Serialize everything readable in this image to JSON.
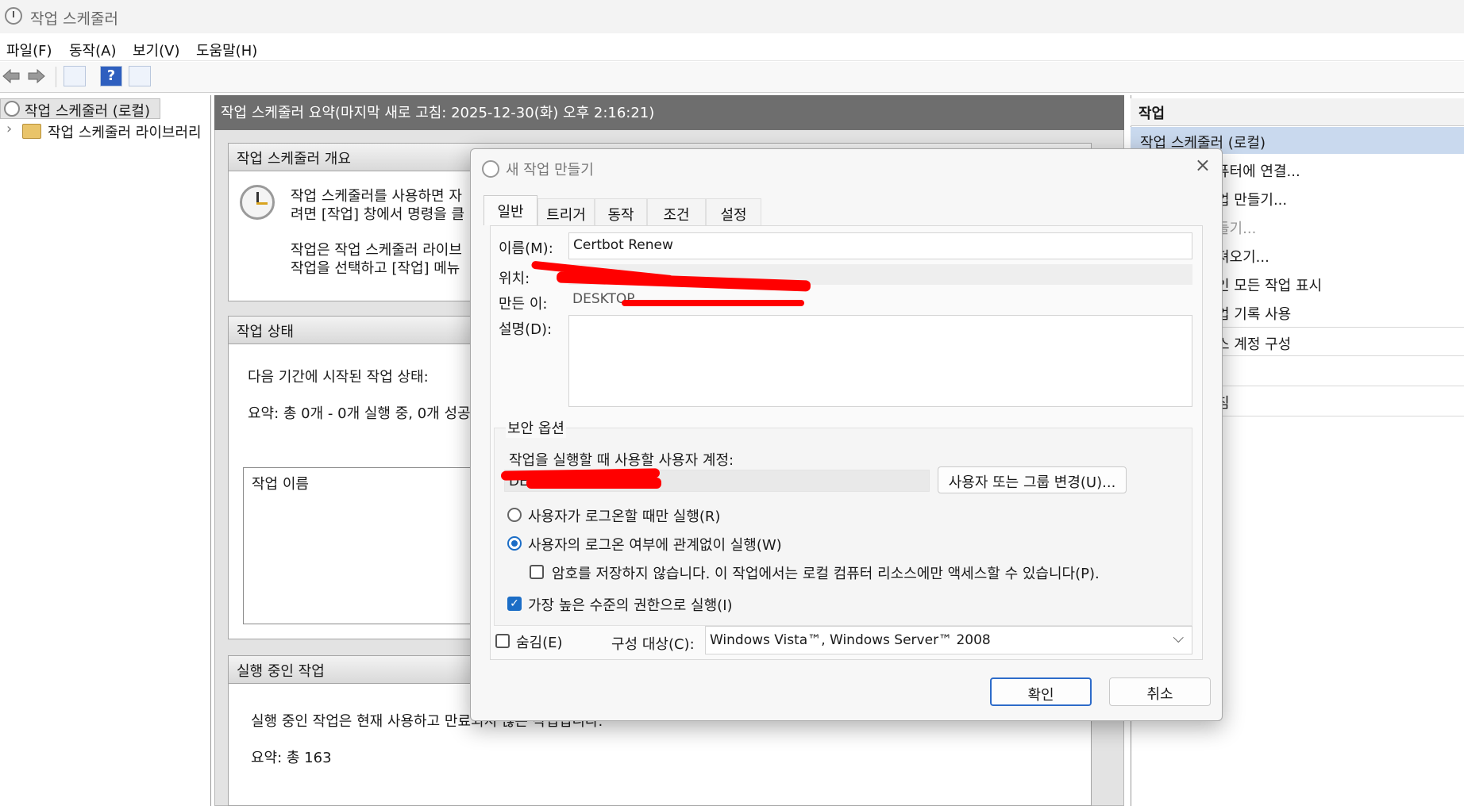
{
  "window": {
    "title": "작업 스케줄러"
  },
  "menu": {
    "items": [
      "파일(F)",
      "동작(A)",
      "보기(V)",
      "도움말(H)"
    ]
  },
  "toolbar": {
    "icons": [
      "back-arrow-icon",
      "forward-arrow-icon",
      "console-tree-icon",
      "help-icon",
      "action-pane-icon"
    ],
    "help_label": "?"
  },
  "tree": {
    "root_label": "작업 스케줄러 (로컬)",
    "child_label": "작업 스케줄러 라이브러리",
    "expander": "›"
  },
  "center": {
    "header": "작업 스케줄러 요약(마지막 새로 고침: 2025-12-30(화) 오후 2:16:21)",
    "overview": {
      "title": "작업 스케줄러 개요",
      "line1": "작업 스케줄러를 사용하면 자",
      "line2": "려면 [작업] 창에서 명령을 클",
      "line3": "작업은 작업 스케줄러 라이브",
      "line4": "작업을 선택하고 [작업] 메뉴"
    },
    "status": {
      "title": "작업 상태",
      "line1": "다음 기간에 시작된 작업 상태:",
      "line2": "요약: 총 0개 - 0개 실행 중, 0개 성공",
      "column": "작업 이름"
    },
    "running": {
      "title": "실행 중인 작업",
      "line1": "실행 중인 작업은 현재 사용하고 만료되지 않은 작업입니다.",
      "line2": "요약: 총 163"
    }
  },
  "actions_pane": {
    "header": "작업",
    "subheader": "작업 스케줄러 (로컬)",
    "items": [
      "퓨터에 연결...",
      "업 만들기...",
      "들기...",
      "져오기...",
      "인 모든 작업 표시",
      "업 기록 사용",
      "스 계정 구성",
      "침"
    ]
  },
  "dialog": {
    "title": "새 작업 만들기",
    "close": "×",
    "tabs": [
      "일반",
      "트리거",
      "동작",
      "조건",
      "설정"
    ],
    "active_tab": "일반",
    "name_label": "이름(M):",
    "name_value": "Certbot Renew",
    "location_label": "위치:",
    "location_value": "₩",
    "author_label": "만든 이:",
    "author_value": "DESKTOP",
    "description_label": "설명(D):",
    "description_value": "",
    "security_group": "보안 옵션",
    "account_label": "작업을 실행할 때 사용할 사용자 계정:",
    "account_value": "DESKTOP",
    "change_user_button": "사용자 또는 그룹 변경(U)...",
    "radio_logged_on": "사용자가 로그온할 때만 실행(R)",
    "radio_whether": "사용자의 로그온 여부에 관계없이 실행(W)",
    "no_store_password": "암호를 저장하지 않습니다. 이 작업에서는 로컬 컴퓨터 리소스에만 액세스할 수 있습니다(P).",
    "highest_privileges": "가장 높은 수준의 권한으로 실행(I)",
    "hidden_label": "숨김(E)",
    "configure_label": "구성 대상(C):",
    "configure_value": "Windows Vista™, Windows Server™ 2008",
    "ok_button": "확인",
    "cancel_button": "취소",
    "checkmark": "✓",
    "dropdown_chevron": "⌵"
  },
  "colors": {
    "accent": "#1b6dc6",
    "redaction": "#ff0000",
    "header_gray": "#6e6e6e",
    "selection": "#c9d9ee"
  }
}
